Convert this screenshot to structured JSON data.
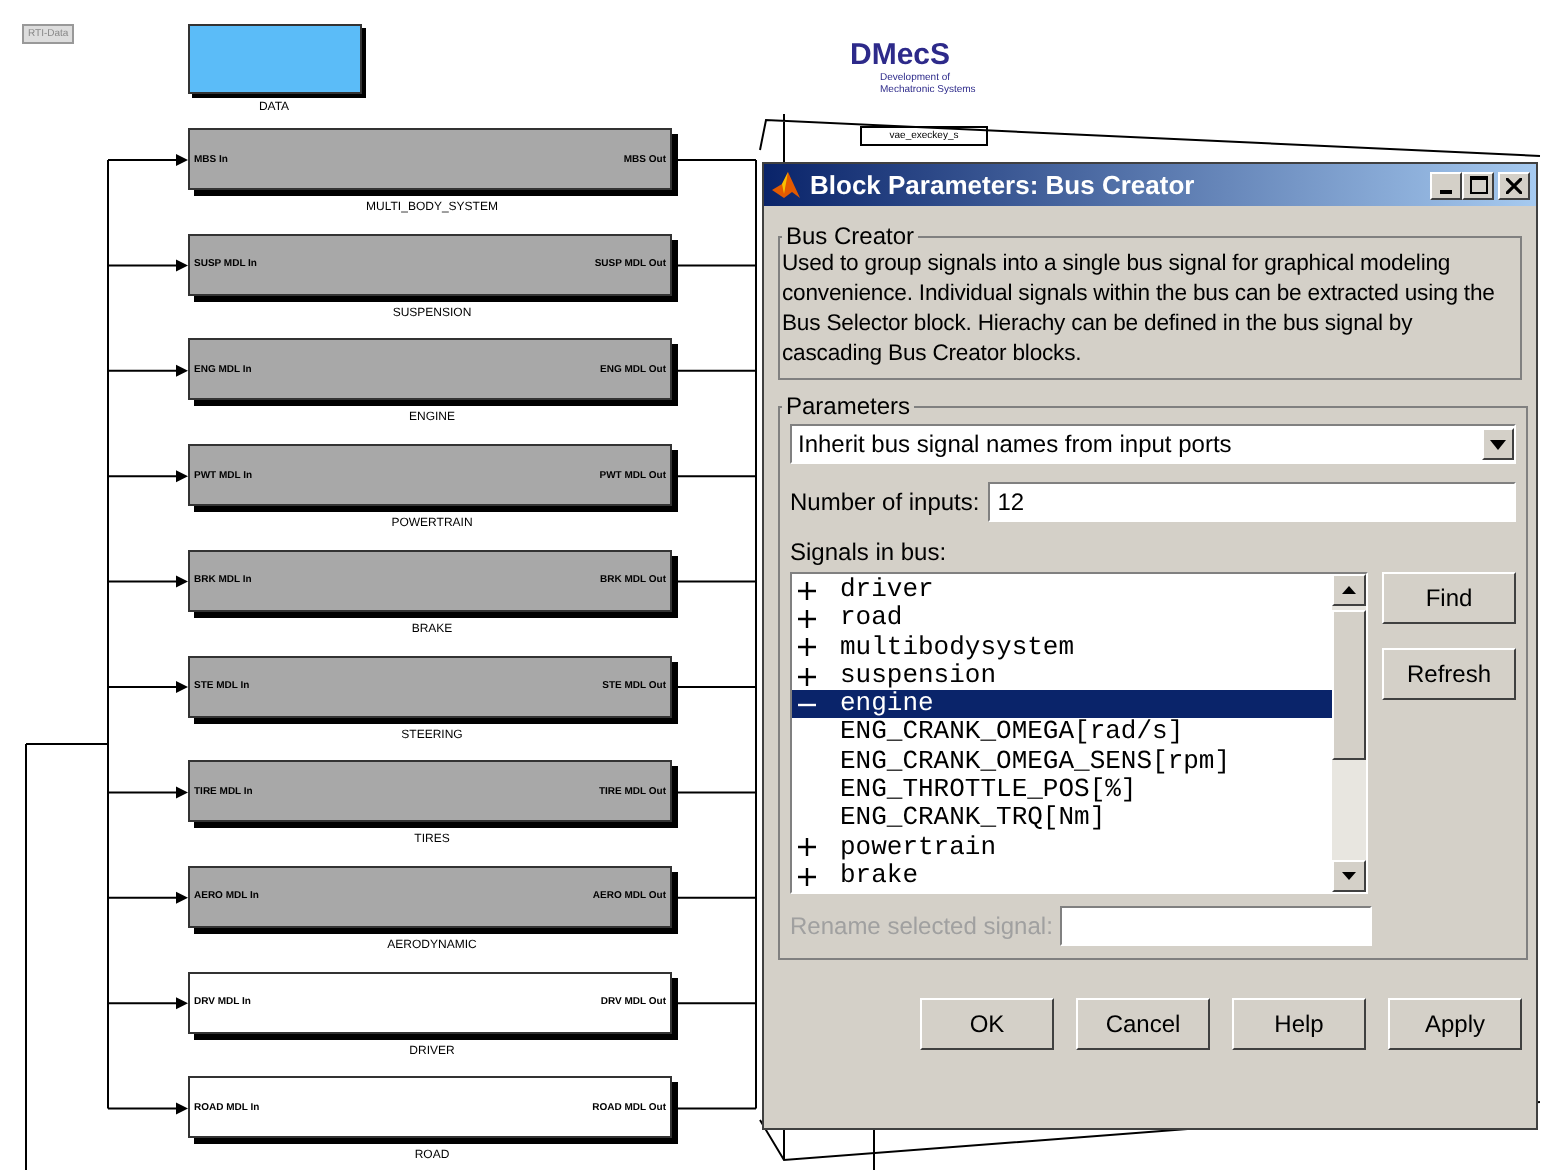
{
  "canvas": {
    "tag": "RTI-Data",
    "data_block": {
      "label": "DATA"
    },
    "logo": {
      "title": "DMecS",
      "subtitle_lines": [
        "Development of",
        "Mechatronic Systems"
      ]
    },
    "key_block": "vae_execkey_s",
    "blocks": [
      {
        "name": "MULTI_BODY_SYSTEM",
        "in": "MBS In",
        "out": "MBS Out",
        "shaded": true
      },
      {
        "name": "SUSPENSION",
        "in": "SUSP MDL In",
        "out": "SUSP MDL Out",
        "shaded": true
      },
      {
        "name": "ENGINE",
        "in": "ENG MDL In",
        "out": "ENG MDL Out",
        "shaded": true
      },
      {
        "name": "POWERTRAIN",
        "in": "PWT MDL In",
        "out": "PWT MDL Out",
        "shaded": true
      },
      {
        "name": "BRAKE",
        "in": "BRK MDL In",
        "out": "BRK MDL Out",
        "shaded": true
      },
      {
        "name": "STEERING",
        "in": "STE MDL In",
        "out": "STE MDL Out",
        "shaded": true
      },
      {
        "name": "TIRES",
        "in": "TIRE MDL In",
        "out": "TIRE MDL Out",
        "shaded": true
      },
      {
        "name": "AERODYNAMIC",
        "in": "AERO MDL In",
        "out": "AERO MDL Out",
        "shaded": true
      },
      {
        "name": "DRIVER",
        "in": "DRV MDL In",
        "out": "DRV MDL Out",
        "shaded": false
      },
      {
        "name": "ROAD",
        "in": "ROAD MDL In",
        "out": "ROAD MDL Out",
        "shaded": false
      }
    ]
  },
  "dialog": {
    "title": "Block Parameters: Bus Creator",
    "description": {
      "legend": "Bus Creator",
      "text": "Used to group signals into a single bus signal for graphical modeling convenience. Individual signals within the bus can be extracted using the Bus Selector block. Hierachy can be defined in the bus signal by cascading Bus Creator blocks."
    },
    "parameters": {
      "legend": "Parameters",
      "naming_mode": "Inherit bus signal names from input ports",
      "inputs_label": "Number of inputs:",
      "inputs_value": "12",
      "signals_label": "Signals in bus:",
      "signals": [
        {
          "name": "driver",
          "expanded": false,
          "selected": false
        },
        {
          "name": "road",
          "expanded": false,
          "selected": false
        },
        {
          "name": "multibodysystem",
          "expanded": false,
          "selected": false
        },
        {
          "name": "suspension",
          "expanded": false,
          "selected": false
        },
        {
          "name": "engine",
          "expanded": true,
          "selected": true,
          "children": [
            {
              "name": "ENG_CRANK_OMEGA[rad/s]",
              "selected": false
            },
            {
              "name": "ENG_CRANK_OMEGA_SENS[rpm]",
              "selected": false
            },
            {
              "name": "ENG_THROTTLE_POS[%]",
              "selected": false
            },
            {
              "name": "ENG_CRANK_TRQ[Nm]",
              "selected": false
            }
          ]
        },
        {
          "name": "powertrain",
          "expanded": false,
          "selected": false
        },
        {
          "name": "brake",
          "expanded": false,
          "selected": false
        }
      ],
      "side_buttons": [
        "Find",
        "Refresh"
      ],
      "rename": {
        "label": "Rename selected signal:",
        "disabled": true
      }
    },
    "buttons": [
      "OK",
      "Cancel",
      "Help",
      "Apply"
    ]
  }
}
